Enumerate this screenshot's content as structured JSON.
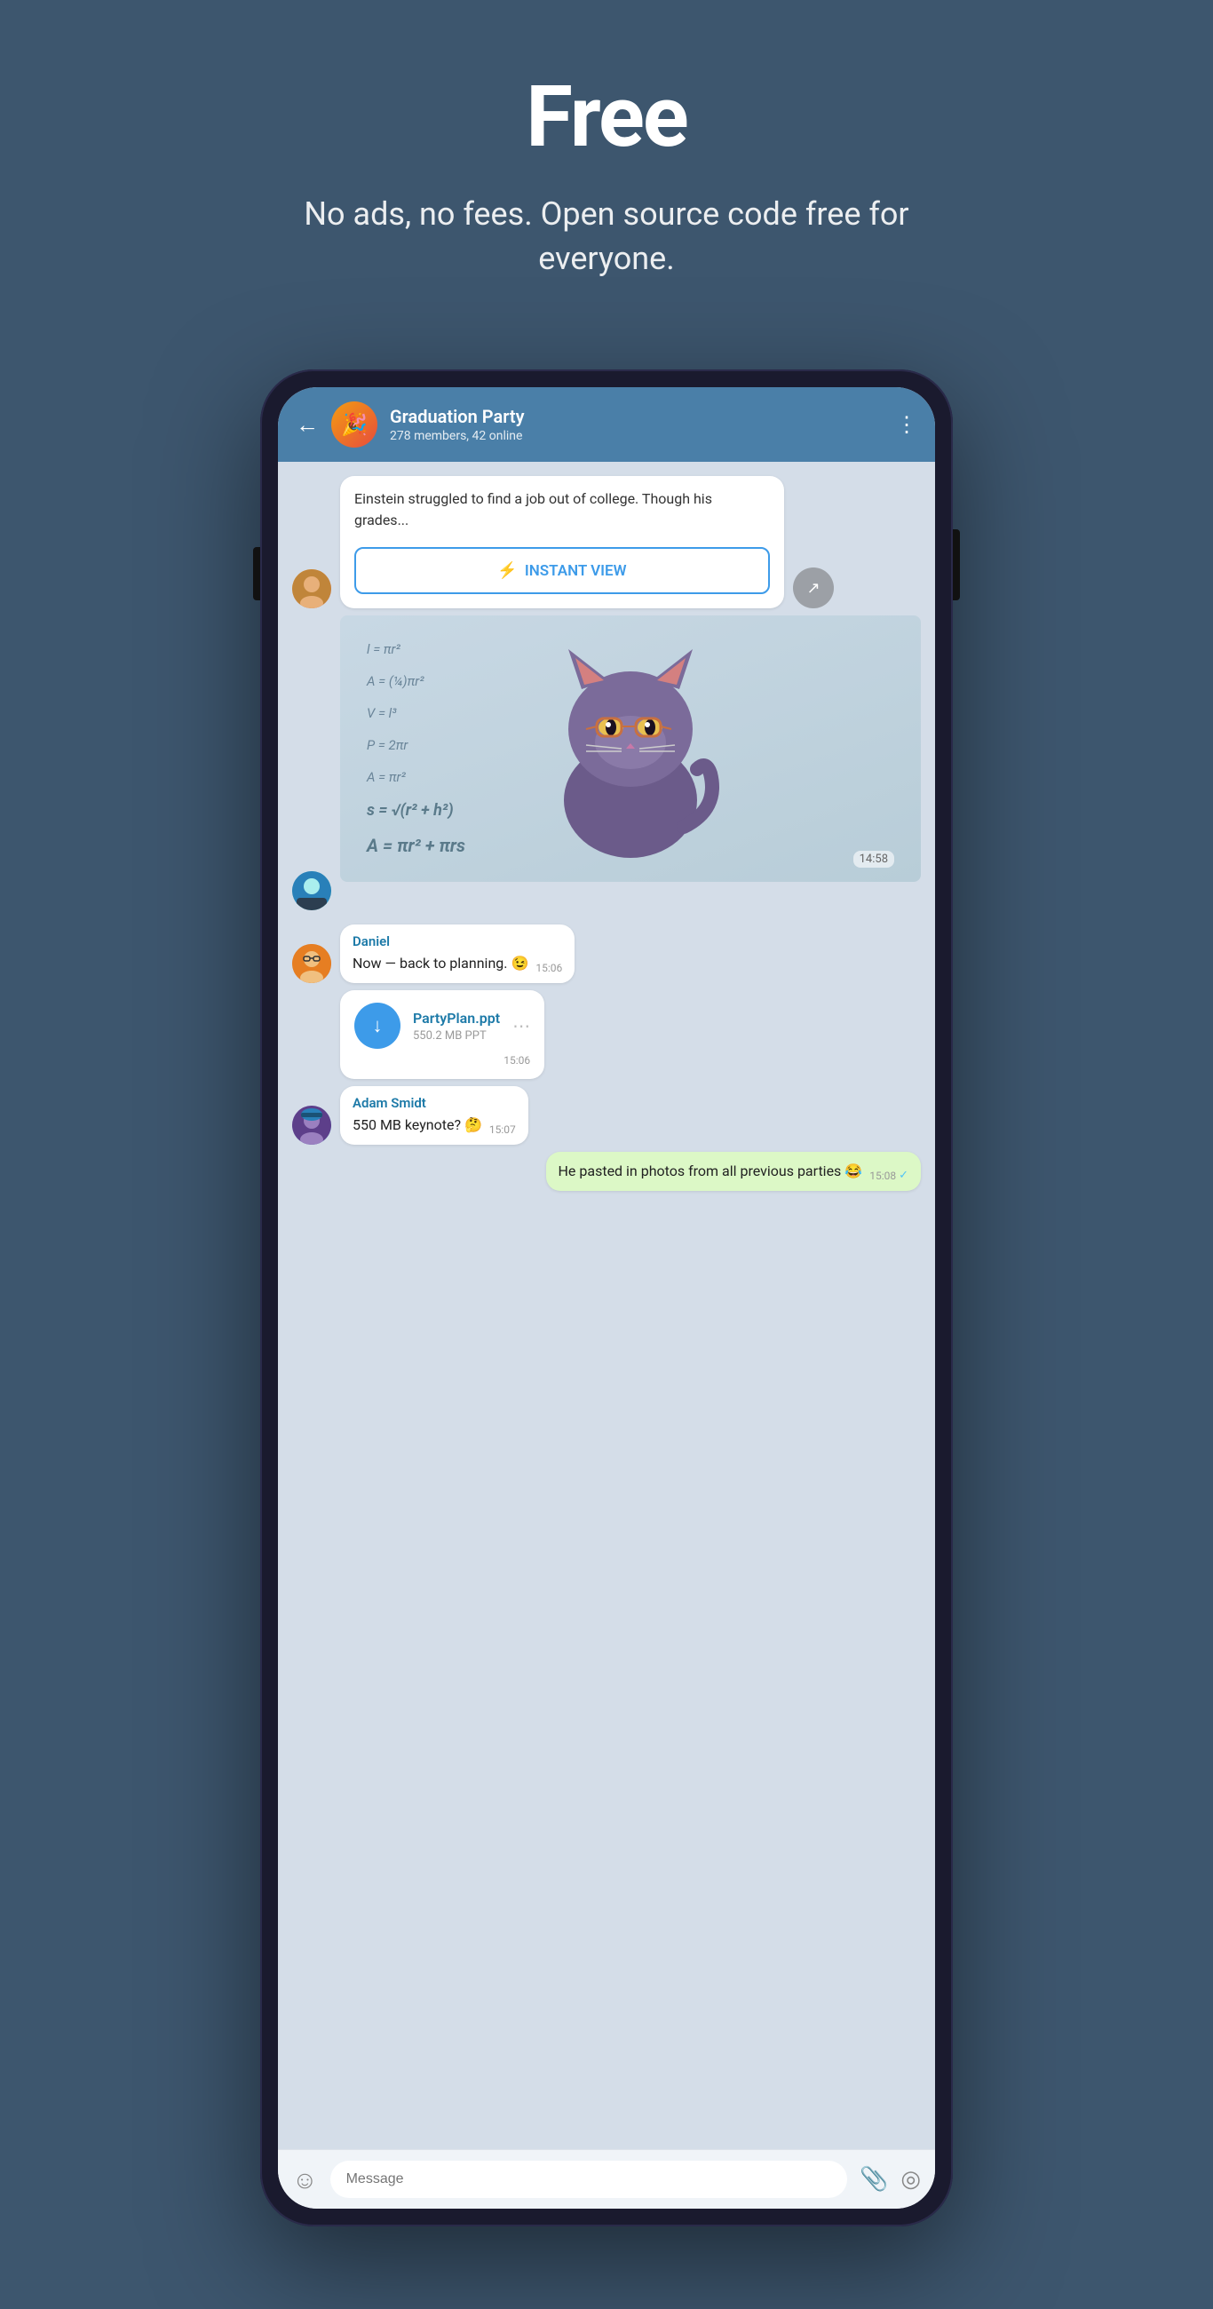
{
  "hero": {
    "title": "Free",
    "subtitle": "No ads, no fees. Open source code free for everyone."
  },
  "phone": {
    "header": {
      "group_name": "Graduation Party",
      "members": "278 members, 42 online",
      "back_label": "←",
      "more_label": "⋮"
    },
    "messages": [
      {
        "id": "iv-msg",
        "type": "instant_view",
        "text": "Einstein struggled to find a job out of college. Though his grades...",
        "button_label": "INSTANT VIEW",
        "flash": "⚡"
      },
      {
        "id": "sticker-msg",
        "type": "sticker",
        "time": "14:58",
        "math_lines": [
          "l = πr²",
          "A = (1/4)πr²",
          "V = l³",
          "P = 2πr",
          "A = πr²",
          "s = √(r² + h²)",
          "A = πr² + πrs"
        ]
      },
      {
        "id": "daniel-msg",
        "type": "text",
        "sender": "Daniel",
        "text": "Now — back to planning. 😉",
        "time": "15:06"
      },
      {
        "id": "file-msg",
        "type": "file",
        "file_name": "PartyPlan.ppt",
        "file_size": "550.2 MB PPT",
        "time": "15:06"
      },
      {
        "id": "adam-msg",
        "type": "text",
        "sender": "Adam Smidt",
        "text": "550 MB keynote? 🤔",
        "time": "15:07"
      },
      {
        "id": "my-msg",
        "type": "text_outgoing",
        "text": "He pasted in photos from all previous parties 😂",
        "time": "15:08",
        "status": "✓"
      }
    ],
    "input": {
      "placeholder": "Message",
      "emoji_icon": "☺",
      "attach_icon": "📎",
      "camera_icon": "◎"
    }
  }
}
